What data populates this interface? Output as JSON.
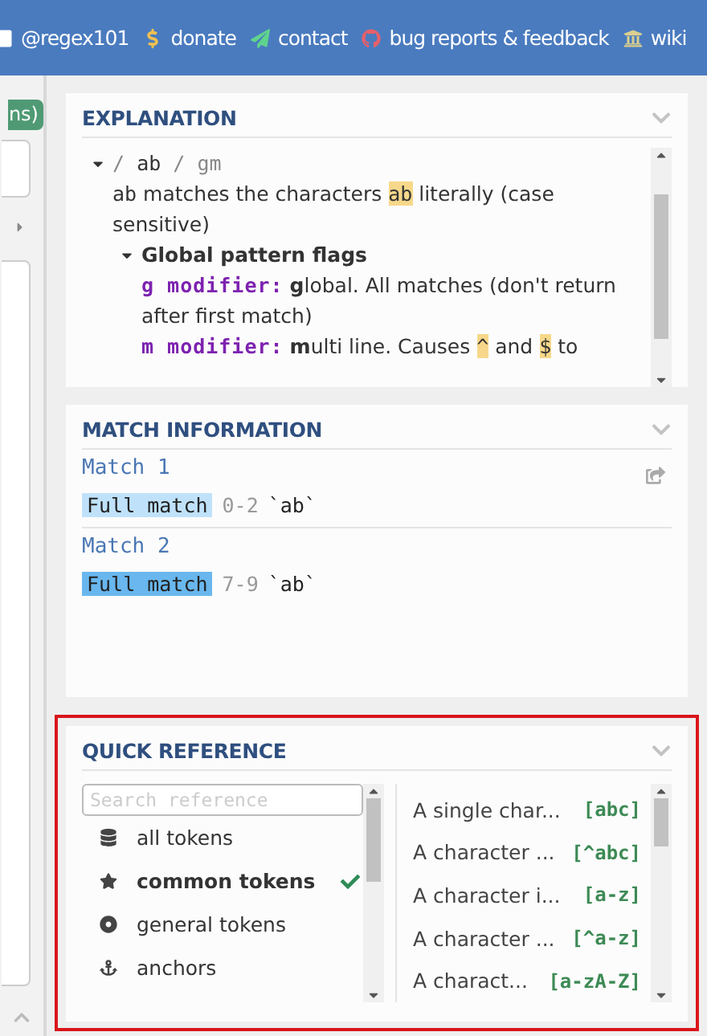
{
  "header_links": [
    {
      "label": "@regex101"
    },
    {
      "label": "donate"
    },
    {
      "label": "contact"
    },
    {
      "label": "bug reports & feedback"
    },
    {
      "label": "wiki"
    }
  ],
  "left_strip": {
    "button_label": "ns)"
  },
  "explanation": {
    "title": "EXPLANATION",
    "pattern": {
      "slash": "/",
      "body": "ab",
      "flags": "gm"
    },
    "parts": [
      {
        "kind": "token",
        "text": "ab"
      },
      {
        "kind": "text",
        "text": " matches the characters "
      },
      {
        "kind": "hl",
        "text": "ab"
      },
      {
        "kind": "text",
        "text": " literally (case sensitive)"
      }
    ],
    "group": {
      "title": "Global pattern flags",
      "expanded": true,
      "flags": [
        {
          "label": "g modifier:",
          "parts": [
            {
              "kind": "text",
              "text": "**g**lobal. All matches (don't return after first match)"
            }
          ]
        },
        {
          "label": "m modifier:",
          "parts": [
            {
              "kind": "text",
              "text": "**m**ulti line. Causes "
            },
            {
              "kind": "hl",
              "text": "^"
            },
            {
              "kind": "text",
              "text": " and "
            },
            {
              "kind": "hl",
              "text": "$"
            },
            {
              "kind": "text",
              "text": " to"
            }
          ]
        }
      ]
    }
  },
  "match_information": {
    "title": "MATCH INFORMATION",
    "matches": [
      {
        "title": "Match 1",
        "label": "Full match",
        "range": "0-2",
        "value": "`ab`",
        "selected": false
      },
      {
        "title": "Match 2",
        "label": "Full match",
        "range": "7-9",
        "value": "`ab`",
        "selected": true
      }
    ]
  },
  "quick_reference": {
    "title": "QUICK REFERENCE",
    "search": {
      "placeholder": "Search reference"
    },
    "categories": [
      {
        "label": "all tokens",
        "selected": false
      },
      {
        "label": "common tokens",
        "selected": true
      },
      {
        "label": "general tokens",
        "selected": false
      },
      {
        "label": "anchors",
        "selected": false
      }
    ],
    "tokens": [
      {
        "description": "A single char...",
        "token": "[abc]"
      },
      {
        "description": "A character ...",
        "token": "[^abc]"
      },
      {
        "description": "A character i...",
        "token": "[a-z]"
      },
      {
        "description": "A character ...",
        "token": "[^a-z]"
      },
      {
        "description": "A charact...",
        "token": "[a-zA-Z]"
      }
    ]
  }
}
